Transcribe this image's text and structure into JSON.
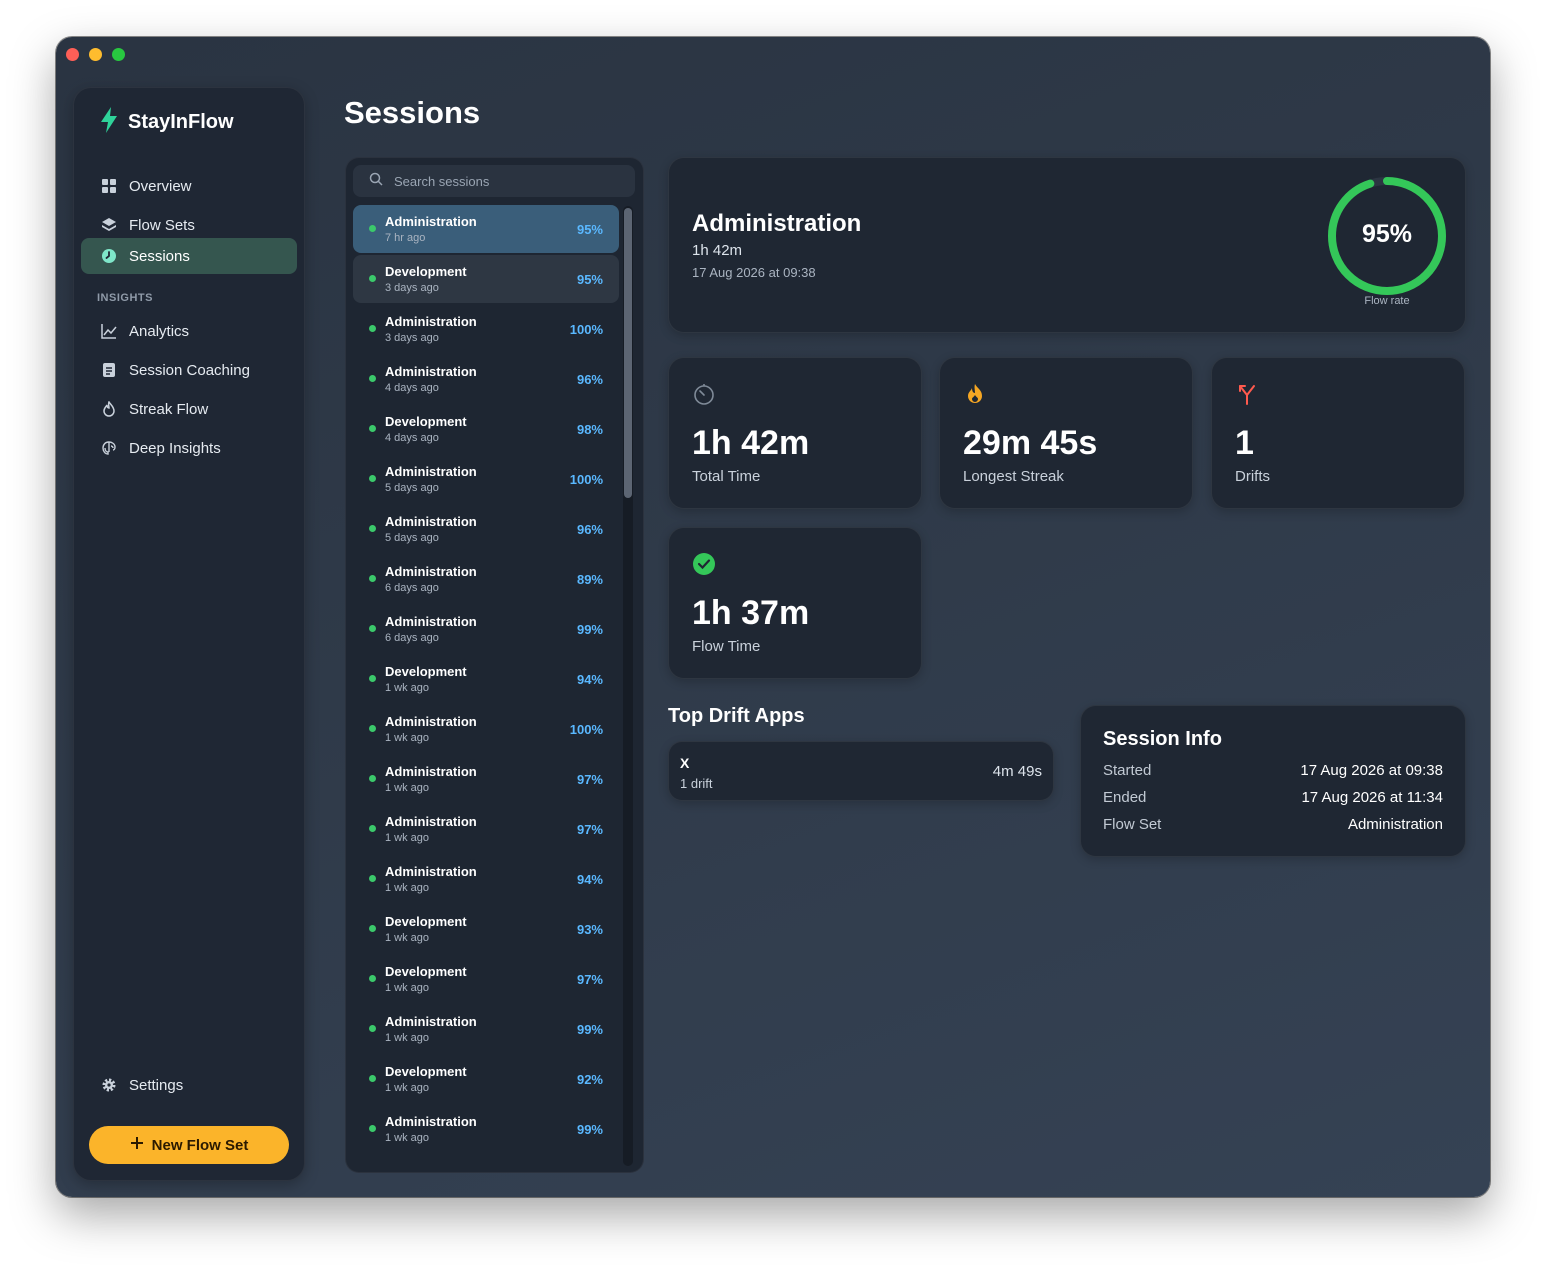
{
  "app": {
    "name": "StayInFlow"
  },
  "sidebar": {
    "nav": [
      {
        "label": "Overview",
        "icon": "grid-icon"
      },
      {
        "label": "Flow Sets",
        "icon": "layers-icon"
      },
      {
        "label": "Sessions",
        "icon": "clock-icon",
        "active": true
      }
    ],
    "section_label": "INSIGHTS",
    "insights": [
      {
        "label": "Analytics",
        "icon": "chart-line-icon"
      },
      {
        "label": "Session Coaching",
        "icon": "clipboard-icon"
      },
      {
        "label": "Streak Flow",
        "icon": "flame-icon"
      },
      {
        "label": "Deep Insights",
        "icon": "brain-icon"
      }
    ],
    "settings_label": "Settings",
    "new_flow_set_label": "New Flow Set"
  },
  "page": {
    "title": "Sessions"
  },
  "search": {
    "placeholder": "Search sessions",
    "value": ""
  },
  "sessions": [
    {
      "name": "Administration",
      "time": "7 hr ago",
      "rate": "95%"
    },
    {
      "name": "Development",
      "time": "3 days ago",
      "rate": "95%"
    },
    {
      "name": "Administration",
      "time": "3 days ago",
      "rate": "100%"
    },
    {
      "name": "Administration",
      "time": "4 days ago",
      "rate": "96%"
    },
    {
      "name": "Development",
      "time": "4 days ago",
      "rate": "98%"
    },
    {
      "name": "Administration",
      "time": "5 days ago",
      "rate": "100%"
    },
    {
      "name": "Administration",
      "time": "5 days ago",
      "rate": "96%"
    },
    {
      "name": "Administration",
      "time": "6 days ago",
      "rate": "89%"
    },
    {
      "name": "Administration",
      "time": "6 days ago",
      "rate": "99%"
    },
    {
      "name": "Development",
      "time": "1 wk ago",
      "rate": "94%"
    },
    {
      "name": "Administration",
      "time": "1 wk ago",
      "rate": "100%"
    },
    {
      "name": "Administration",
      "time": "1 wk ago",
      "rate": "97%"
    },
    {
      "name": "Administration",
      "time": "1 wk ago",
      "rate": "97%"
    },
    {
      "name": "Administration",
      "time": "1 wk ago",
      "rate": "94%"
    },
    {
      "name": "Development",
      "time": "1 wk ago",
      "rate": "93%"
    },
    {
      "name": "Development",
      "time": "1 wk ago",
      "rate": "97%"
    },
    {
      "name": "Administration",
      "time": "1 wk ago",
      "rate": "99%"
    },
    {
      "name": "Development",
      "time": "1 wk ago",
      "rate": "92%"
    },
    {
      "name": "Administration",
      "time": "1 wk ago",
      "rate": "99%"
    }
  ],
  "detail": {
    "title": "Administration",
    "duration": "1h 42m",
    "date": "17 Aug 2026 at 09:38",
    "flow_rate": {
      "value": "95%",
      "label": "Flow rate",
      "fraction": 0.95,
      "color": "#34c759"
    },
    "stats": {
      "total_time": {
        "value": "1h 42m",
        "label": "Total Time",
        "icon": "timer-icon"
      },
      "longest_streak": {
        "value": "29m 45s",
        "label": "Longest Streak",
        "icon": "flame-icon"
      },
      "drifts": {
        "value": "1",
        "label": "Drifts",
        "icon": "fork-icon"
      },
      "flow_time": {
        "value": "1h 37m",
        "label": "Flow Time",
        "icon": "check-circle-icon"
      }
    },
    "top_drift_apps": {
      "title": "Top Drift Apps",
      "apps": [
        {
          "name": "X",
          "drifts": "1 drift",
          "duration": "4m 49s"
        }
      ]
    },
    "session_info": {
      "title": "Session Info",
      "rows": [
        {
          "key": "Started",
          "value": "17 Aug 2026 at 09:38"
        },
        {
          "key": "Ended",
          "value": "17 Aug 2026 at 11:34"
        },
        {
          "key": "Flow Set",
          "value": "Administration"
        }
      ]
    }
  },
  "colors": {
    "accent": "#3bc96b",
    "selected_row": "#3a5e7a",
    "rate_text": "#5ab8ff",
    "primary_button": "#fbb42a",
    "active_nav": "#35564f"
  }
}
